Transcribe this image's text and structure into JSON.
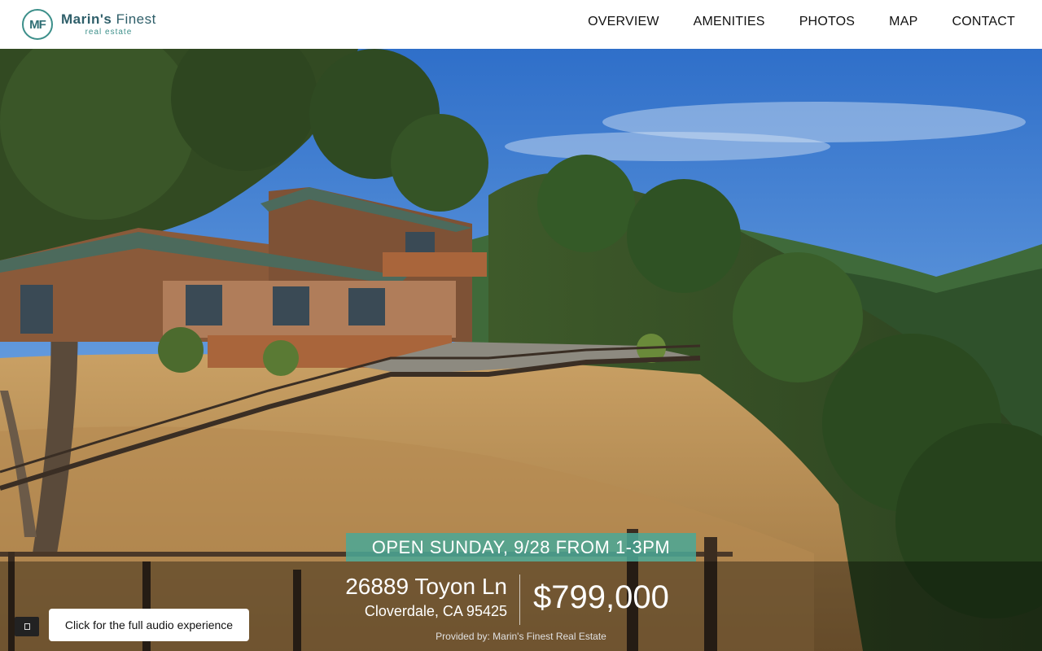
{
  "brand": {
    "monogram": "MF",
    "name_bold": "Marin's",
    "name_rest": " Finest",
    "tagline": "real estate",
    "accent_color": "#3c8f8a"
  },
  "nav": {
    "items": [
      {
        "label": "OVERVIEW"
      },
      {
        "label": "AMENITIES"
      },
      {
        "label": "PHOTOS"
      },
      {
        "label": "MAP"
      },
      {
        "label": "CONTACT"
      }
    ]
  },
  "hero": {
    "open_house": "OPEN SUNDAY, 9/28 FROM 1-3PM",
    "street": "26889 Toyon Ln",
    "city": "Cloverdale, CA 95425",
    "price": "$799,000",
    "provided_by": "Provided by: Marin's Finest Real Estate",
    "banner_color": "#4aa896"
  },
  "audio": {
    "label": "Click for the full audio experience",
    "icon": "speaker-icon"
  }
}
